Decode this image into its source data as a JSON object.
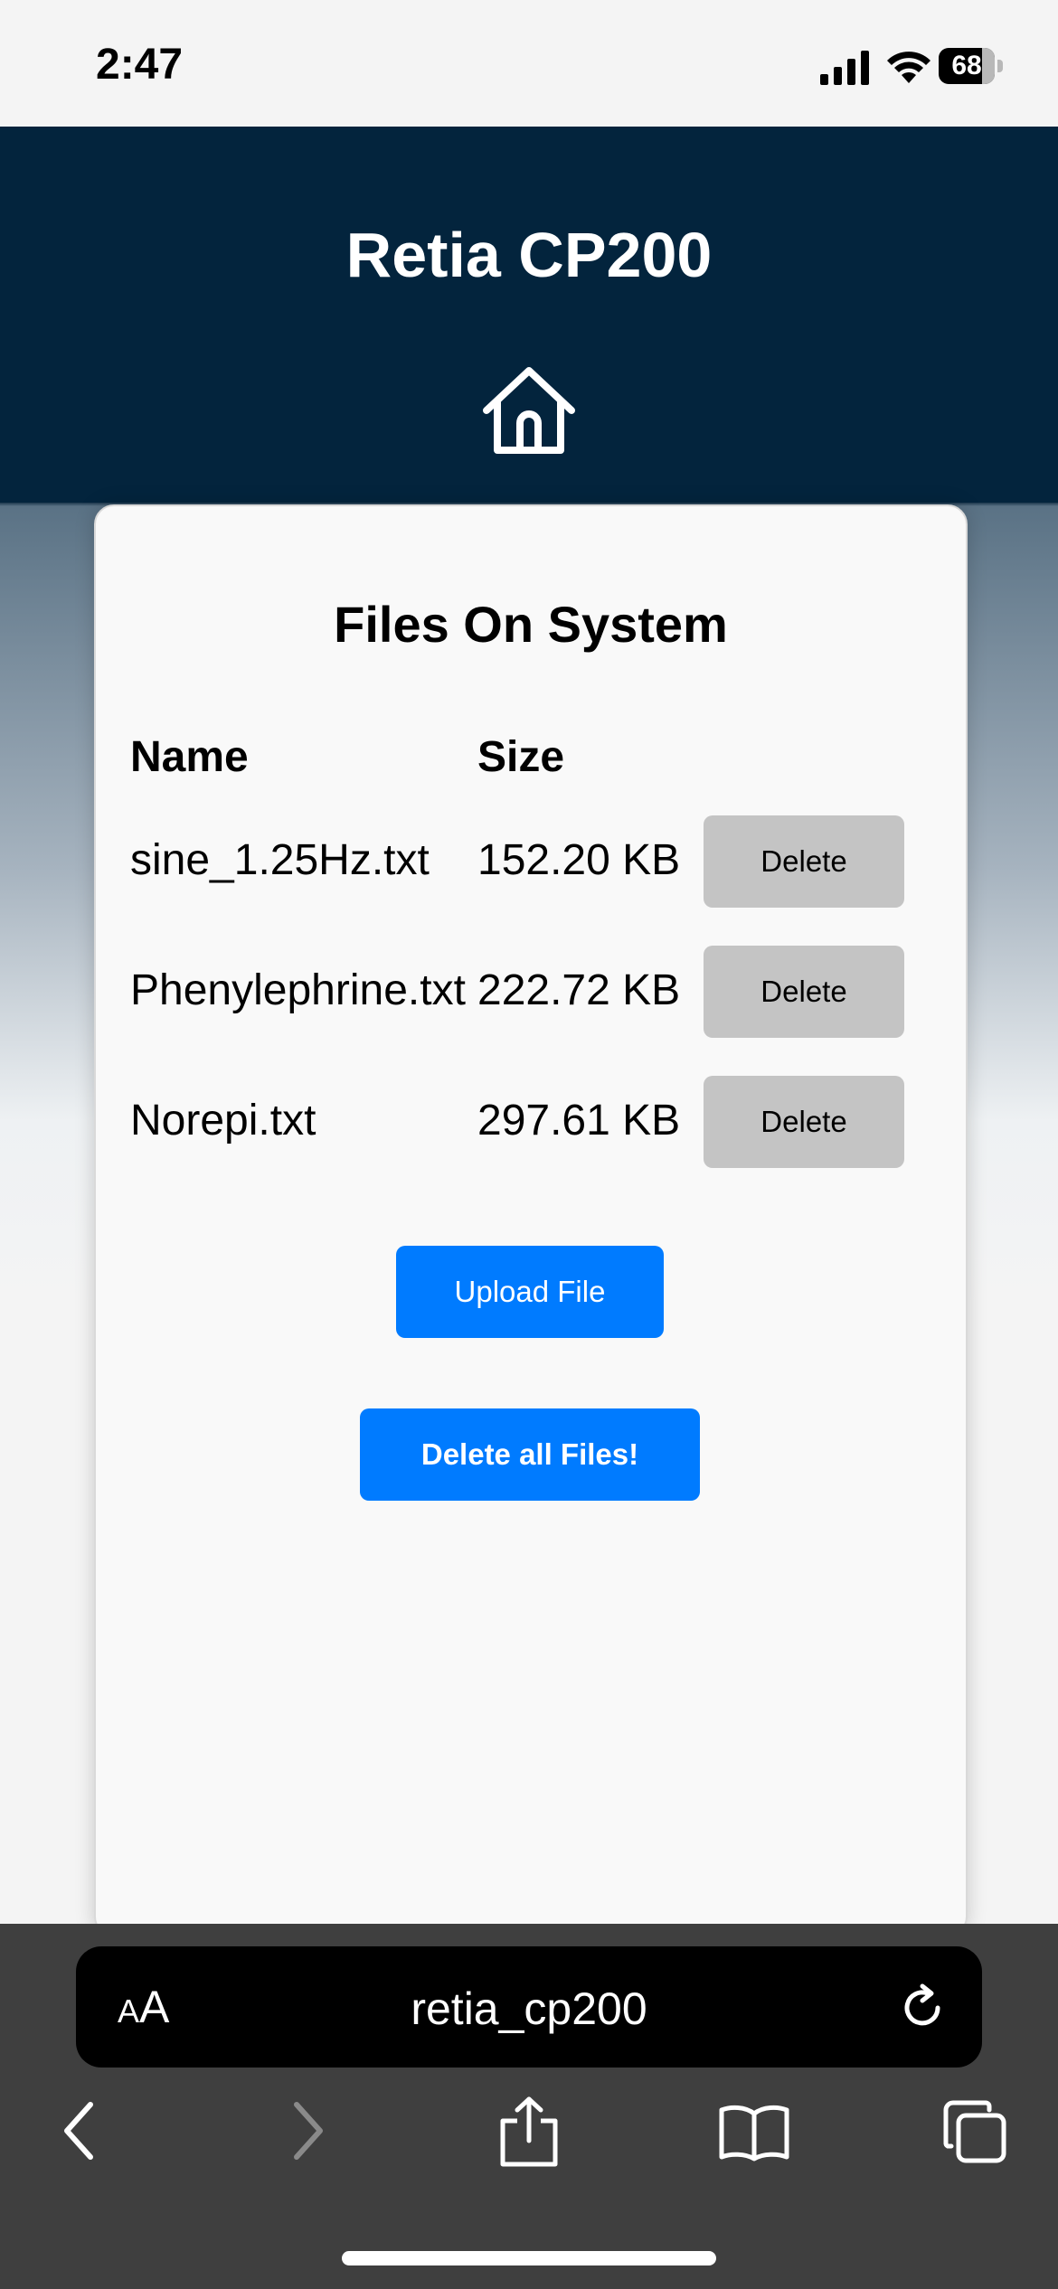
{
  "status_bar": {
    "time": "2:47",
    "battery_level": "68"
  },
  "header": {
    "title": "Retia CP200",
    "home_icon": "home-icon"
  },
  "card": {
    "title": "Files On System",
    "columns": {
      "name": "Name",
      "size": "Size"
    },
    "files": [
      {
        "name": "sine_1.25Hz.txt",
        "size": "152.20 KB",
        "action": "Delete"
      },
      {
        "name": "Phenylephrine.txt",
        "size": "222.72 KB",
        "action": "Delete"
      },
      {
        "name": "Norepi.txt",
        "size": "297.61 KB",
        "action": "Delete"
      }
    ],
    "upload_label": "Upload File",
    "delete_all_label": "Delete all Files!"
  },
  "browser": {
    "text_size_label": "AA",
    "url": "retia_cp200",
    "toolbar_icons": [
      "back-icon",
      "forward-icon",
      "share-icon",
      "bookmarks-icon",
      "tabs-icon"
    ]
  },
  "colors": {
    "header_bg": "#03243d",
    "primary_button": "#007bff",
    "delete_button": "#c4c4c4",
    "toolbar_bg": "#3f3f3f"
  }
}
